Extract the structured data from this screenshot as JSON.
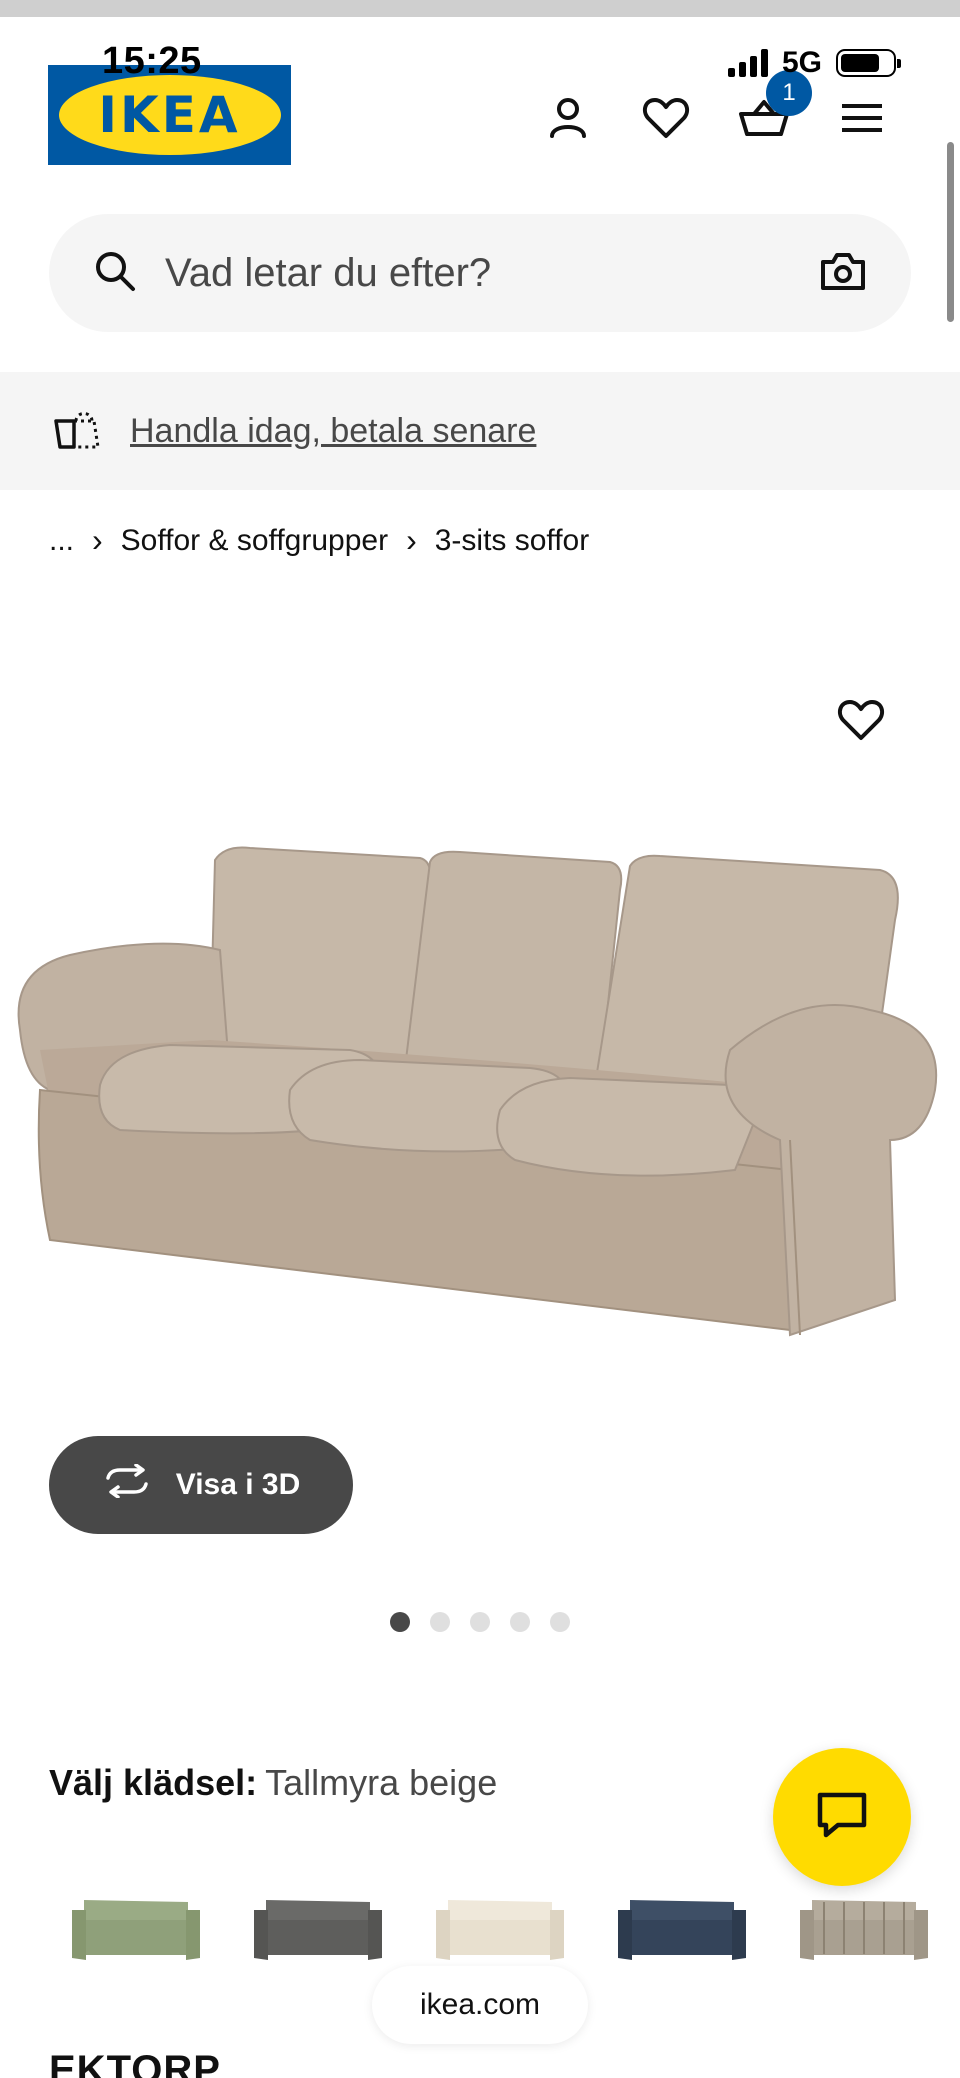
{
  "status_bar": {
    "time": "15:25",
    "network": "5G"
  },
  "header": {
    "logo_text": "IKEA",
    "cart_count": "1",
    "icons": [
      "user-icon",
      "heart-icon",
      "basket-icon",
      "menu-icon"
    ]
  },
  "search": {
    "placeholder": "Vad letar du efter?"
  },
  "promo": {
    "text": "Handla idag, betala senare"
  },
  "breadcrumb": {
    "ellipsis": "...",
    "items": [
      "Soffor & soffgrupper",
      "3-sits soffor"
    ]
  },
  "view3d": {
    "label": "Visa i 3D"
  },
  "carousel": {
    "total": 5,
    "active_index": 0
  },
  "fabric": {
    "label": "Välj klädsel:",
    "value": "Tallmyra beige"
  },
  "swatches": [
    {
      "color": "#8fa07a"
    },
    {
      "color": "#5e5e5c"
    },
    {
      "color": "#e8e0cf"
    },
    {
      "color": "#34445a"
    },
    {
      "color": "#a9a091"
    }
  ],
  "browser": {
    "domain": "ikea.com"
  },
  "product": {
    "name": "EKTORP"
  },
  "colors": {
    "brand_blue": "#0058a3",
    "brand_yellow": "#ffda1a",
    "chat_yellow": "#ffdb00",
    "sofa": "#c2b3a3"
  }
}
